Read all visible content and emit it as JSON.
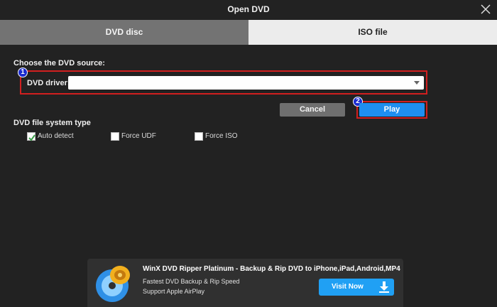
{
  "window": {
    "title": "Open DVD",
    "close_icon": "close-icon"
  },
  "tabs": [
    {
      "label": "DVD disc",
      "active": true
    },
    {
      "label": "ISO file",
      "active": false
    }
  ],
  "source": {
    "heading": "Choose the DVD source:",
    "driver_label": "DVD driver:",
    "driver_value": "",
    "annotation_1": "1"
  },
  "buttons": {
    "cancel": "Cancel",
    "play": "Play",
    "annotation_2": "2"
  },
  "file_system": {
    "heading": "DVD file system type",
    "options": [
      {
        "label": "Auto detect",
        "checked": true
      },
      {
        "label": "Force UDF",
        "checked": false
      },
      {
        "label": "Force ISO",
        "checked": false
      }
    ]
  },
  "ad": {
    "title": "WinX DVD Ripper Platinum - Backup & Rip DVD to iPhone,iPad,Android,MP4",
    "line1": "Fastest DVD Backup & Rip Speed",
    "line2": "Support Apple AirPlay",
    "button": "Visit Now"
  },
  "colors": {
    "background": "#222222",
    "active_tab": "#737373",
    "inactive_tab": "#ececec",
    "highlight_border": "#d11f1f",
    "play_button": "#1e8ff0",
    "badge": "#1b2bd0"
  }
}
